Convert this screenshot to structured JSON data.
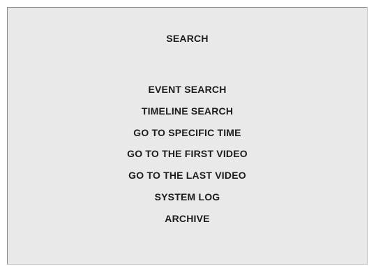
{
  "dialog": {
    "title": "SEARCH",
    "items": [
      {
        "label": "EVENT SEARCH"
      },
      {
        "label": "TIMELINE SEARCH"
      },
      {
        "label": "GO TO SPECIFIC TIME"
      },
      {
        "label": "GO TO THE FIRST VIDEO"
      },
      {
        "label": "GO TO THE LAST VIDEO"
      },
      {
        "label": "SYSTEM LOG"
      },
      {
        "label": "ARCHIVE"
      }
    ]
  },
  "colors": {
    "panel_background": "#e9e9e9",
    "text": "#1c1c1c",
    "border": "#8a8a8a"
  }
}
